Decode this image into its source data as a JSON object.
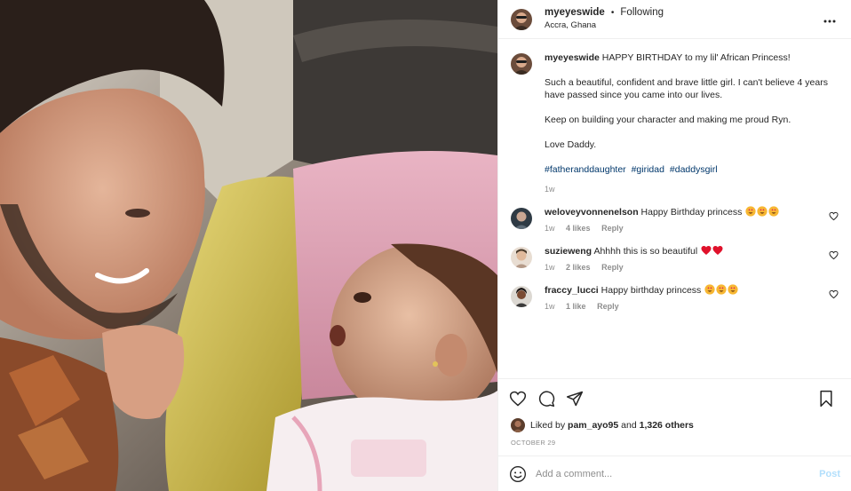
{
  "post": {
    "username": "myeyeswide",
    "follow_status": "Following",
    "separator": "•",
    "location": "Accra, Ghana"
  },
  "caption": {
    "username": "myeyeswide",
    "line1": "HAPPY BIRTHDAY to my lil' African Princess!",
    "para2": "Such a beautiful, confident and brave little girl. I can't believe 4 years have passed since you came into our lives.",
    "para3": "Keep on building your character and making me proud Ryn.",
    "para4": "Love Daddy.",
    "hashtags": [
      "#fatheranddaughter",
      "#giridad",
      "#daddysgirl"
    ],
    "time": "1w"
  },
  "comments": [
    {
      "username": "weloveyvonnenelson",
      "text": "Happy Birthday princess",
      "emoji": [
        "heart-eyes",
        "heart-eyes",
        "heart-eyes"
      ],
      "time": "1w",
      "likes": "4 likes",
      "reply": "Reply"
    },
    {
      "username": "suzieweng",
      "text": "Ahhhh this is so beautiful",
      "emoji": [
        "red-heart",
        "red-heart"
      ],
      "time": "1w",
      "likes": "2 likes",
      "reply": "Reply"
    },
    {
      "username": "fraccy_lucci",
      "text": "Happy birthday princess",
      "emoji": [
        "heart-eyes",
        "heart-eyes",
        "heart-eyes"
      ],
      "time": "1w",
      "likes": "1 like",
      "reply": "Reply"
    }
  ],
  "likes": {
    "prefix": "Liked by",
    "user": "pam_ayo95",
    "conj": "and",
    "others": "1,326 others"
  },
  "date": "OCTOBER 29",
  "add_comment": {
    "placeholder": "Add a comment...",
    "post_label": "Post"
  },
  "colors": {
    "link": "#00376b",
    "muted": "#8e8e8e",
    "post_disabled": "#b2dffc",
    "border": "#efefef"
  }
}
